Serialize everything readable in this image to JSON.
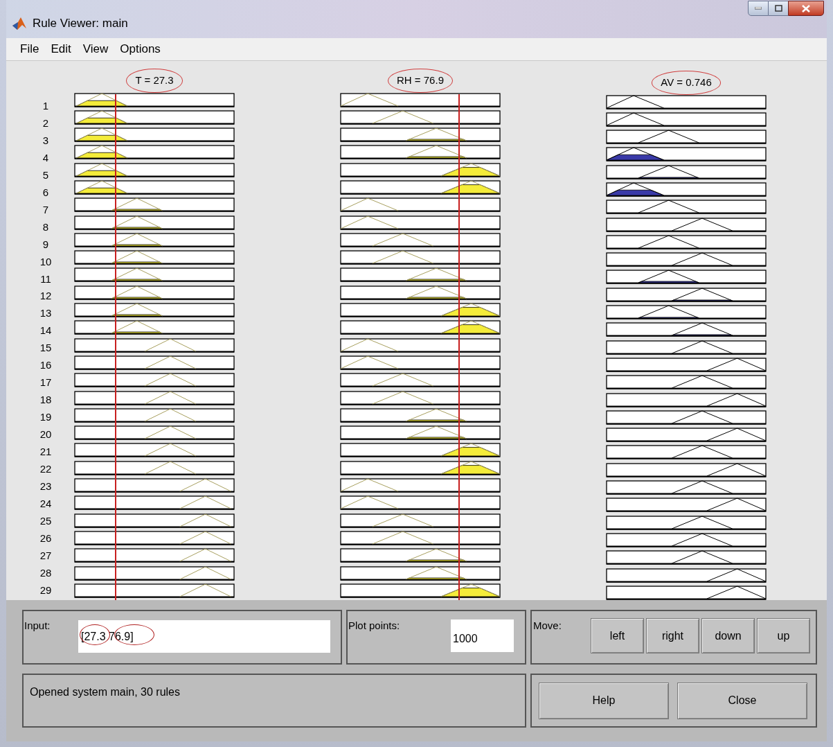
{
  "window": {
    "title": "Rule Viewer: main"
  },
  "menu": [
    "File",
    "Edit",
    "View",
    "Options"
  ],
  "columns": [
    {
      "kind": "input",
      "header": "T = 27.3",
      "circled": true,
      "cursor": true
    },
    {
      "kind": "input",
      "header": "RH = 76.9",
      "circled": true,
      "cursor": true
    },
    {
      "kind": "output",
      "header": "AV = 0.746",
      "circled": true
    }
  ],
  "rules": [
    {
      "number": "1",
      "cells": [
        {
          "kind": "left",
          "fill": {
            "kind": "medium"
          }
        },
        {
          "kind": "left"
        },
        {
          "kind": "left"
        }
      ]
    },
    {
      "number": "2",
      "cells": [
        {
          "kind": "left",
          "fill": {
            "kind": "medium"
          }
        },
        {
          "kind": "midleft"
        },
        {
          "kind": "left"
        }
      ]
    },
    {
      "number": "3",
      "cells": [
        {
          "kind": "left",
          "fill": {
            "kind": "medium"
          }
        },
        {
          "kind": "midright",
          "fill": {
            "kind": "low"
          }
        },
        {
          "kind": "midleft"
        }
      ]
    },
    {
      "number": "4",
      "cells": [
        {
          "kind": "left",
          "fill": {
            "kind": "medium"
          }
        },
        {
          "kind": "midright",
          "fill": {
            "kind": "low"
          }
        },
        {
          "kind": "left",
          "fill": {
            "kind": "medium"
          }
        }
      ]
    },
    {
      "number": "5",
      "cells": [
        {
          "kind": "left",
          "fill": {
            "kind": "medium"
          }
        },
        {
          "kind": "right",
          "fill": {
            "kind": "high"
          }
        },
        {
          "kind": "midleft",
          "fill": {
            "kind": "trace"
          }
        }
      ]
    },
    {
      "number": "6",
      "cells": [
        {
          "kind": "left",
          "fill": {
            "kind": "medium"
          }
        },
        {
          "kind": "right",
          "fill": {
            "kind": "high"
          }
        },
        {
          "kind": "left",
          "fill": {
            "kind": "medium"
          }
        }
      ]
    },
    {
      "number": "7",
      "cells": [
        {
          "kind": "midleft",
          "fill": {
            "kind": "low"
          }
        },
        {
          "kind": "left"
        },
        {
          "kind": "midleft"
        }
      ]
    },
    {
      "number": "8",
      "cells": [
        {
          "kind": "midleft",
          "fill": {
            "kind": "low"
          }
        },
        {
          "kind": "left"
        },
        {
          "kind": "midright"
        }
      ]
    },
    {
      "number": "9",
      "cells": [
        {
          "kind": "midleft",
          "fill": {
            "kind": "low"
          }
        },
        {
          "kind": "midleft"
        },
        {
          "kind": "midleft"
        }
      ]
    },
    {
      "number": "10",
      "cells": [
        {
          "kind": "midleft",
          "fill": {
            "kind": "low"
          }
        },
        {
          "kind": "midleft"
        },
        {
          "kind": "midright"
        }
      ]
    },
    {
      "number": "11",
      "cells": [
        {
          "kind": "midleft",
          "fill": {
            "kind": "low"
          }
        },
        {
          "kind": "midright",
          "fill": {
            "kind": "low"
          }
        },
        {
          "kind": "midleft",
          "fill": {
            "kind": "low"
          }
        }
      ]
    },
    {
      "number": "12",
      "cells": [
        {
          "kind": "midleft",
          "fill": {
            "kind": "low"
          }
        },
        {
          "kind": "midright",
          "fill": {
            "kind": "low"
          }
        },
        {
          "kind": "midright",
          "fill": {
            "kind": "trace"
          }
        }
      ]
    },
    {
      "number": "13",
      "cells": [
        {
          "kind": "midleft",
          "fill": {
            "kind": "low"
          }
        },
        {
          "kind": "right",
          "fill": {
            "kind": "high"
          }
        },
        {
          "kind": "midleft",
          "fill": {
            "kind": "trace"
          }
        }
      ]
    },
    {
      "number": "14",
      "cells": [
        {
          "kind": "midleft",
          "fill": {
            "kind": "low"
          }
        },
        {
          "kind": "right",
          "fill": {
            "kind": "high"
          }
        },
        {
          "kind": "midright",
          "fill": {
            "kind": "trace"
          }
        }
      ]
    },
    {
      "number": "15",
      "cells": [
        {
          "kind": "midright"
        },
        {
          "kind": "left"
        },
        {
          "kind": "midright"
        }
      ]
    },
    {
      "number": "16",
      "cells": [
        {
          "kind": "midright"
        },
        {
          "kind": "left"
        },
        {
          "kind": "right"
        }
      ]
    },
    {
      "number": "17",
      "cells": [
        {
          "kind": "midright"
        },
        {
          "kind": "midleft"
        },
        {
          "kind": "midright"
        }
      ]
    },
    {
      "number": "18",
      "cells": [
        {
          "kind": "midright"
        },
        {
          "kind": "midleft"
        },
        {
          "kind": "right"
        }
      ]
    },
    {
      "number": "19",
      "cells": [
        {
          "kind": "midright"
        },
        {
          "kind": "midright",
          "fill": {
            "kind": "low"
          }
        },
        {
          "kind": "midright"
        }
      ]
    },
    {
      "number": "20",
      "cells": [
        {
          "kind": "midright"
        },
        {
          "kind": "midright",
          "fill": {
            "kind": "low"
          }
        },
        {
          "kind": "right"
        }
      ]
    },
    {
      "number": "21",
      "cells": [
        {
          "kind": "midright"
        },
        {
          "kind": "right",
          "fill": {
            "kind": "high"
          }
        },
        {
          "kind": "midright"
        }
      ]
    },
    {
      "number": "22",
      "cells": [
        {
          "kind": "midright"
        },
        {
          "kind": "right",
          "fill": {
            "kind": "high"
          }
        },
        {
          "kind": "right"
        }
      ]
    },
    {
      "number": "23",
      "cells": [
        {
          "kind": "right"
        },
        {
          "kind": "left"
        },
        {
          "kind": "midright"
        }
      ]
    },
    {
      "number": "24",
      "cells": [
        {
          "kind": "right"
        },
        {
          "kind": "left"
        },
        {
          "kind": "right"
        }
      ]
    },
    {
      "number": "25",
      "cells": [
        {
          "kind": "right"
        },
        {
          "kind": "midleft"
        },
        {
          "kind": "midright"
        }
      ]
    },
    {
      "number": "26",
      "cells": [
        {
          "kind": "right"
        },
        {
          "kind": "midleft"
        },
        {
          "kind": "midright"
        }
      ]
    },
    {
      "number": "27",
      "cells": [
        {
          "kind": "right"
        },
        {
          "kind": "midright",
          "fill": {
            "kind": "low"
          }
        },
        {
          "kind": "midright"
        }
      ]
    },
    {
      "number": "28",
      "cells": [
        {
          "kind": "right"
        },
        {
          "kind": "midright",
          "fill": {
            "kind": "low"
          }
        },
        {
          "kind": "right"
        }
      ]
    },
    {
      "number": "29",
      "cells": [
        {
          "kind": "right"
        },
        {
          "kind": "right",
          "fill": {
            "kind": "high"
          }
        },
        {
          "kind": "right"
        }
      ]
    }
  ],
  "input": {
    "label": "Input:",
    "value": "[27.3 76.9]",
    "annotated": true
  },
  "plot_points": {
    "label": "Plot points:",
    "value": "1000"
  },
  "move": {
    "label": "Move:",
    "buttons": [
      "left",
      "right",
      "down",
      "up"
    ]
  },
  "status": "Opened system main, 30 rules",
  "buttons": [
    "Help",
    "Close"
  ]
}
